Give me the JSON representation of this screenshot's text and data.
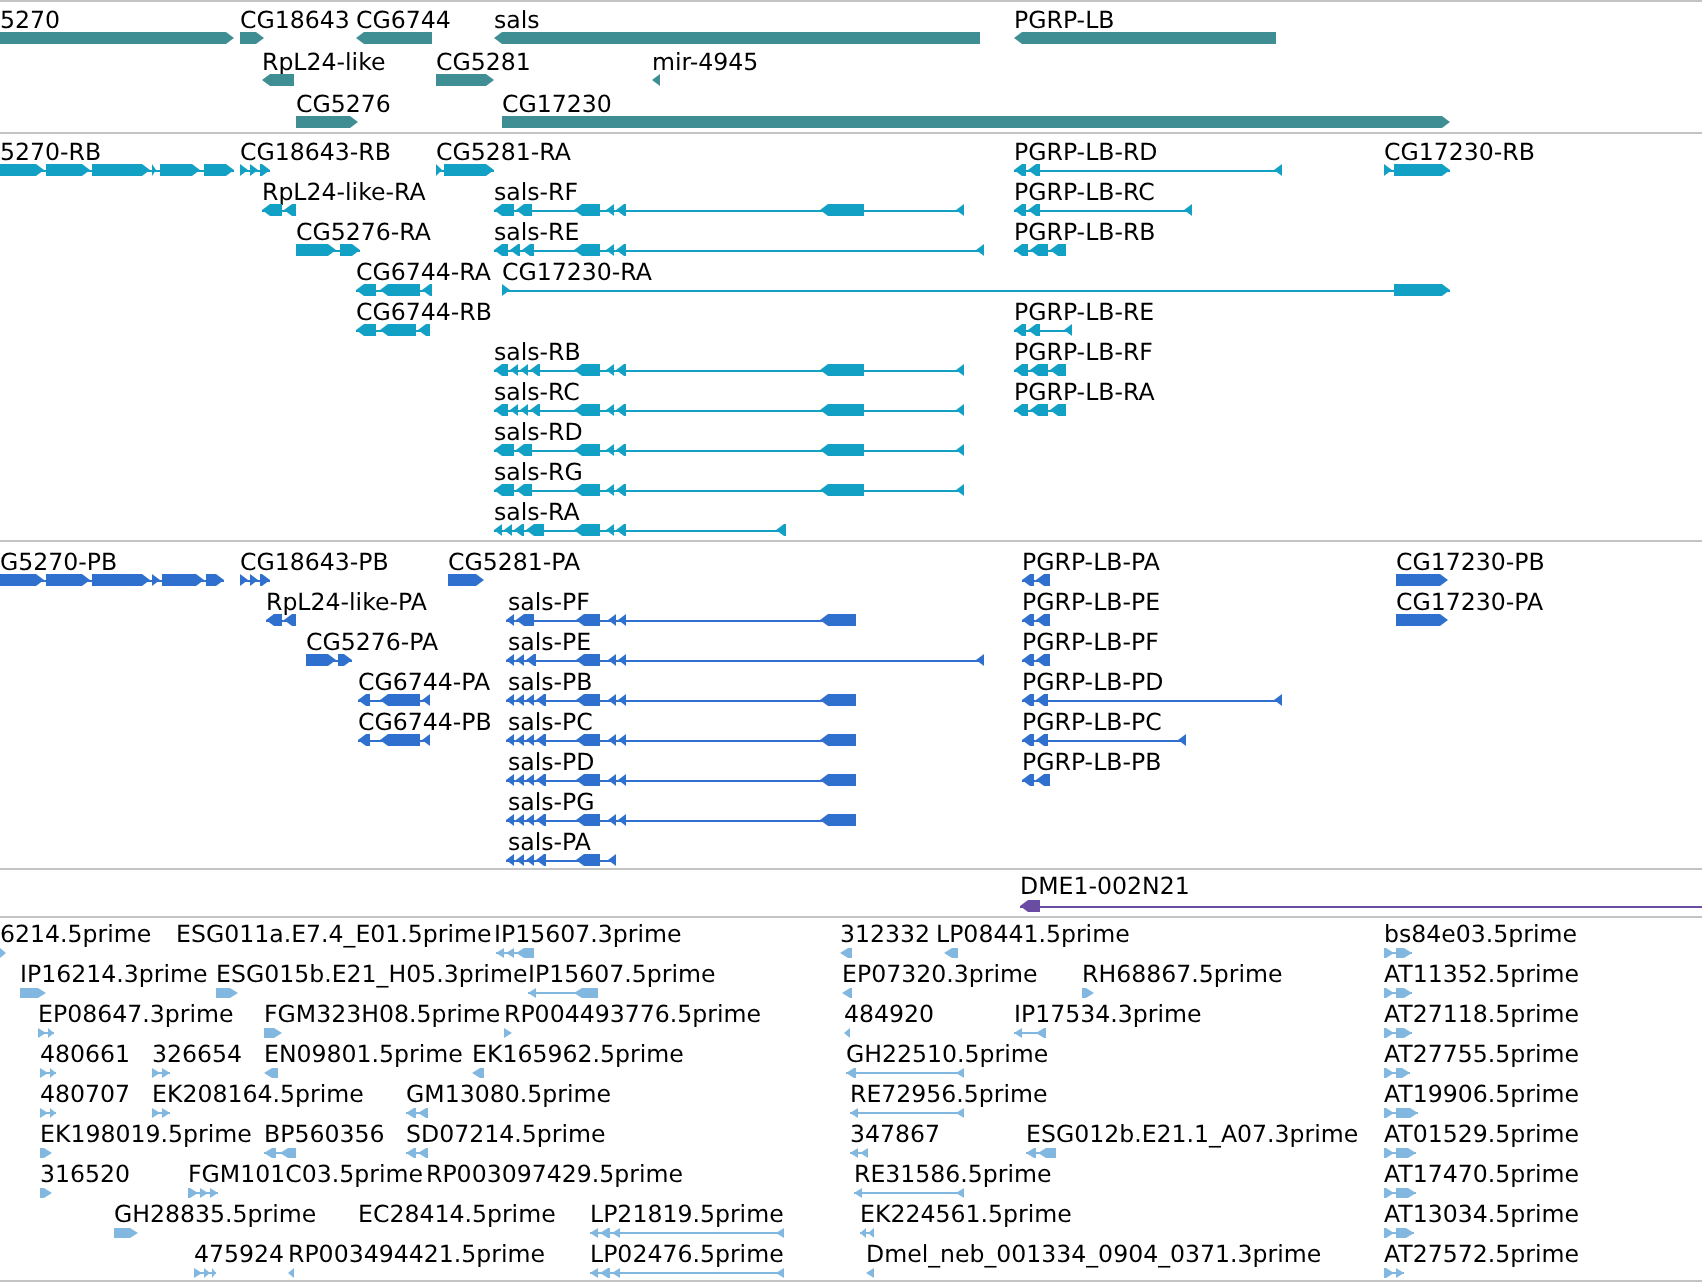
{
  "tracks": [
    {
      "color": "#3f8e93",
      "features": [
        {
          "label": "5270",
          "reverse": false
        },
        {
          "label": "CG18643",
          "reverse": false
        },
        {
          "label": "CG6744",
          "reverse": true
        },
        {
          "label": "sals",
          "reverse": true
        },
        {
          "label": "PGRP-LB",
          "reverse": true
        },
        {
          "label": "RpL24-like",
          "reverse": true
        },
        {
          "label": "CG5281",
          "reverse": false
        },
        {
          "label": "mir-4945",
          "reverse": true
        },
        {
          "label": "CG5276",
          "reverse": false
        },
        {
          "label": "CG17230",
          "reverse": false
        }
      ]
    },
    {
      "color": "#12a0c4",
      "features": [
        {
          "label": "5270-RB",
          "reverse": false
        },
        {
          "label": "CG18643-RB",
          "reverse": false
        },
        {
          "label": "CG5281-RA",
          "reverse": false
        },
        {
          "label": "PGRP-LB-RD",
          "reverse": true
        },
        {
          "label": "CG17230-RB",
          "reverse": false
        },
        {
          "label": "RpL24-like-RA",
          "reverse": true
        },
        {
          "label": "sals-RF",
          "reverse": true
        },
        {
          "label": "PGRP-LB-RC",
          "reverse": true
        },
        {
          "label": "CG5276-RA",
          "reverse": false
        },
        {
          "label": "sals-RE",
          "reverse": true
        },
        {
          "label": "PGRP-LB-RB",
          "reverse": true
        },
        {
          "label": "CG6744-RA",
          "reverse": true
        },
        {
          "label": "CG17230-RA",
          "reverse": false
        },
        {
          "label": "CG6744-RB",
          "reverse": true
        },
        {
          "label": "PGRP-LB-RE",
          "reverse": true
        },
        {
          "label": "sals-RB",
          "reverse": true
        },
        {
          "label": "PGRP-LB-RF",
          "reverse": true
        },
        {
          "label": "sals-RC",
          "reverse": true
        },
        {
          "label": "PGRP-LB-RA",
          "reverse": true
        },
        {
          "label": "sals-RD",
          "reverse": true
        },
        {
          "label": "sals-RG",
          "reverse": true
        },
        {
          "label": "sals-RA",
          "reverse": true
        }
      ]
    },
    {
      "color": "#2f6fce",
      "features": [
        {
          "label": "G5270-PB",
          "reverse": false
        },
        {
          "label": "CG18643-PB",
          "reverse": false
        },
        {
          "label": "CG5281-PA",
          "reverse": false
        },
        {
          "label": "PGRP-LB-PA",
          "reverse": true
        },
        {
          "label": "CG17230-PB",
          "reverse": false
        },
        {
          "label": "RpL24-like-PA",
          "reverse": true
        },
        {
          "label": "sals-PF",
          "reverse": true
        },
        {
          "label": "PGRP-LB-PE",
          "reverse": true
        },
        {
          "label": "CG17230-PA",
          "reverse": false
        },
        {
          "label": "CG5276-PA",
          "reverse": false
        },
        {
          "label": "sals-PE",
          "reverse": true
        },
        {
          "label": "PGRP-LB-PF",
          "reverse": true
        },
        {
          "label": "CG6744-PA",
          "reverse": true
        },
        {
          "label": "sals-PB",
          "reverse": true
        },
        {
          "label": "PGRP-LB-PD",
          "reverse": true
        },
        {
          "label": "CG6744-PB",
          "reverse": true
        },
        {
          "label": "sals-PC",
          "reverse": true
        },
        {
          "label": "PGRP-LB-PC",
          "reverse": true
        },
        {
          "label": "sals-PD",
          "reverse": true
        },
        {
          "label": "PGRP-LB-PB",
          "reverse": true
        },
        {
          "label": "sals-PG",
          "reverse": true
        },
        {
          "label": "sals-PA",
          "reverse": true
        }
      ]
    },
    {
      "color": "#6b4ca4",
      "features": [
        {
          "label": "DME1-002N21",
          "reverse": true
        }
      ]
    },
    {
      "color": "#82b8e0",
      "features": [
        {
          "label": "6214.5prime",
          "reverse": false
        },
        {
          "label": "ESG011a.E7.4_E01.5prime"
        },
        {
          "label": "IP15607.3prime",
          "reverse": true
        },
        {
          "label": "312332",
          "reverse": true
        },
        {
          "label": "LP08441.5prime",
          "reverse": true
        },
        {
          "label": "bs84e03.5prime",
          "reverse": false
        },
        {
          "label": "IP16214.3prime",
          "reverse": false
        },
        {
          "label": "ESG015b.E21_H05.3prime",
          "reverse": false
        },
        {
          "label": "IP15607.5prime",
          "reverse": true
        },
        {
          "label": "EP07320.3prime",
          "reverse": true
        },
        {
          "label": "RH68867.5prime",
          "reverse": false
        },
        {
          "label": "AT11352.5prime",
          "reverse": false
        },
        {
          "label": "EP08647.3prime",
          "reverse": false
        },
        {
          "label": "FGM323H08.5prime",
          "reverse": false
        },
        {
          "label": "RP004493776.5prime",
          "reverse": false
        },
        {
          "label": "484920",
          "reverse": true
        },
        {
          "label": "IP17534.3prime",
          "reverse": true
        },
        {
          "label": "AT27118.5prime",
          "reverse": false
        },
        {
          "label": "480661",
          "reverse": false
        },
        {
          "label": "326654",
          "reverse": false
        },
        {
          "label": "EN09801.5prime",
          "reverse": true
        },
        {
          "label": "EK165962.5prime",
          "reverse": true
        },
        {
          "label": "GH22510.5prime",
          "reverse": true
        },
        {
          "label": "AT27755.5prime",
          "reverse": false
        },
        {
          "label": "480707",
          "reverse": false
        },
        {
          "label": "EK208164.5prime",
          "reverse": false
        },
        {
          "label": "GM13080.5prime",
          "reverse": true
        },
        {
          "label": "RE72956.5prime",
          "reverse": true
        },
        {
          "label": "AT19906.5prime",
          "reverse": false
        },
        {
          "label": "EK198019.5prime",
          "reverse": false
        },
        {
          "label": "BP560356",
          "reverse": true
        },
        {
          "label": "SD07214.5prime",
          "reverse": true
        },
        {
          "label": "347867",
          "reverse": true
        },
        {
          "label": "ESG012b.E21.1_A07.3prime",
          "reverse": true
        },
        {
          "label": "AT01529.5prime",
          "reverse": false
        },
        {
          "label": "316520",
          "reverse": false
        },
        {
          "label": "FGM101C03.5prime",
          "reverse": false
        },
        {
          "label": "RP003097429.5prime"
        },
        {
          "label": "RE31586.5prime",
          "reverse": true
        },
        {
          "label": "AT17470.5prime",
          "reverse": false
        },
        {
          "label": "GH28835.5prime",
          "reverse": false
        },
        {
          "label": "EC28414.5prime"
        },
        {
          "label": "LP21819.5prime",
          "reverse": true
        },
        {
          "label": "EK224561.5prime",
          "reverse": true
        },
        {
          "label": "AT13034.5prime",
          "reverse": false
        },
        {
          "label": "475924",
          "reverse": false
        },
        {
          "label": "RP003494421.5prime",
          "reverse": true
        },
        {
          "label": "LP02476.5prime",
          "reverse": true
        },
        {
          "label": "Dmel_neb_001334_0904_0371.3prime",
          "reverse": true
        },
        {
          "label": "AT27572.5prime",
          "reverse": false
        }
      ]
    }
  ]
}
